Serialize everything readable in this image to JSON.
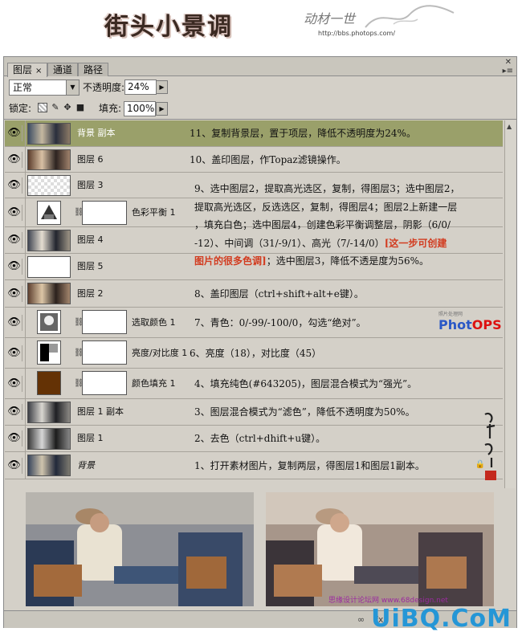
{
  "banner": {
    "title": "街头小景调",
    "signature": "动材一世",
    "url": "http://bbs.photops.com/"
  },
  "tabs": [
    {
      "label": "图层",
      "close": "×"
    },
    {
      "label": "通道"
    },
    {
      "label": "路径"
    }
  ],
  "controls": {
    "blend_mode": "正常",
    "opacity_label": "不透明度:",
    "opacity_value": "24%",
    "lock_label": "锁定:",
    "fill_label": "填充:",
    "fill_value": "100%"
  },
  "layers": [
    {
      "name": "背景 副本",
      "note": "11、复制背景层，置于项层，降低不透明度为24%。"
    },
    {
      "name": "图层 6",
      "note": "10、盖印图层，作Topaz滤镜操作。"
    },
    {
      "name": "图层 3"
    },
    {
      "name": "色彩平衡 1"
    },
    {
      "name": "图层 4"
    },
    {
      "name": "图层 5"
    },
    {
      "name": "图层 2",
      "note": "8、盖印图层（ctrl+shift+alt+e键）。"
    },
    {
      "name": "选取颜色 1",
      "note": "7、青色：0/-99/-100/0，勾选“绝对”。"
    },
    {
      "name": "亮度/对比度 1",
      "note": "6、亮度（18），对比度（45）"
    },
    {
      "name": "颜色填充 1",
      "note": "4、填充纯色(#643205)，图层混合模式为“强光”。"
    },
    {
      "name": "图层 1 副本",
      "note": "3、图层混合模式为“滤色”，降低不透明度为50%。"
    },
    {
      "name": "图层 1",
      "note": "2、去色（ctrl+dhift+u键）。"
    },
    {
      "name": "背景",
      "note": "1、打开素材图片，复制两层，得图层1和图层1副本。"
    }
  ],
  "note9": {
    "line1": "9、选中图层2，提取高光选区，复制，得图层3；选中图层2，",
    "line2": "提取高光选区，反选选区，复制，得图层4；图层2上新建一层",
    "line3": "，填充白色；选中图层4，创建色彩平衡调整层，阴影（6/0/",
    "line4a": "-12）、中间调（31/-9/1）、高光（7/-14/0）",
    "line4b": "[这一步可创建",
    "line5a": "图片的很多色调]",
    "line5b": "；选中图层3，降低不透是度为56%。"
  },
  "logo": {
    "small": "照片处理网",
    "brand": "PhotOPS"
  },
  "watermark": {
    "text": "思缘设计论坛网 www.68design.net"
  },
  "footer": {
    "site": "UiBQ.CoM"
  },
  "colors": {
    "selected_row": "#9aa06a",
    "fill_swatch": "#643205",
    "brand_blue": "#2596d6",
    "note_red": "#d23b1f"
  }
}
